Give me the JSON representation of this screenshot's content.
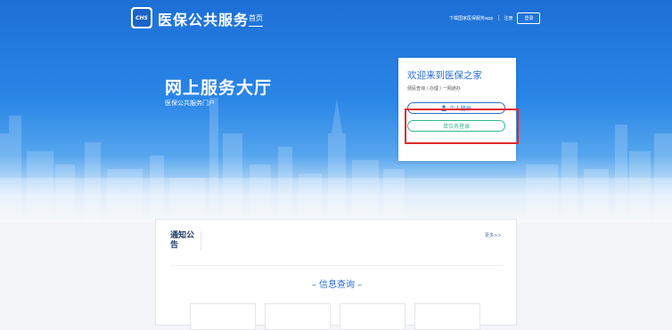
{
  "header": {
    "logo_text": "CHS",
    "site_name": "医保公共服务",
    "nav_home": "首页",
    "download_app": "下载国家医保服务app",
    "separator": "|",
    "register": "注册",
    "login": "登录"
  },
  "hero": {
    "title": "网上服务大厅",
    "subtitle": "医保公共服务门户"
  },
  "welcome_card": {
    "title": "欢迎来到医保之家",
    "subtitle": "便民查询 / 办理 / 一网通办",
    "personal_login": "个人登录",
    "unit_login": "单位务登录"
  },
  "notice": {
    "title": "通知公告",
    "more": "更多>>",
    "info_query": "信息查询"
  },
  "colors": {
    "brand_blue": "#1d6fd6",
    "accent_green": "#2fb98e",
    "highlight_red": "#e02a2a"
  }
}
